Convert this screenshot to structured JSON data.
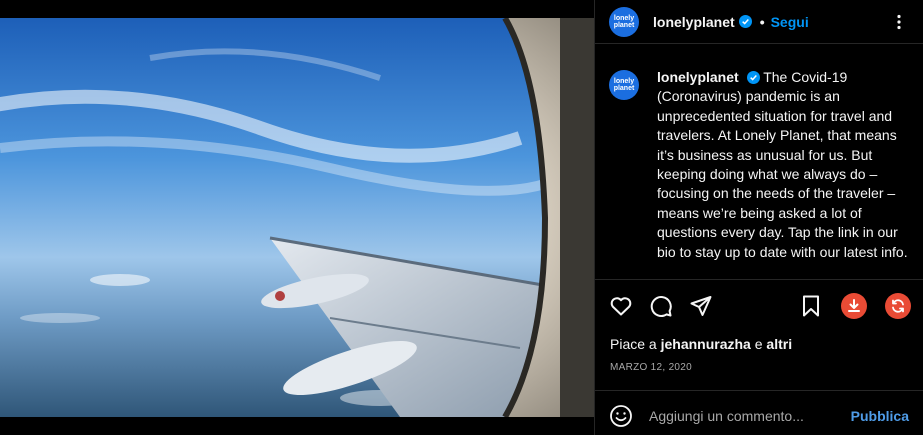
{
  "post": {
    "image_alt": "Airplane wing seen through cabin window above the clouds"
  },
  "header": {
    "avatar_line1": "lonely",
    "avatar_line2": "planet",
    "username": "lonelyplanet",
    "separator": "•",
    "follow_label": "Segui"
  },
  "caption": {
    "username": "lonelyplanet",
    "text": "The Covid-19 (Coronavirus) pandemic is an unprecedented situation for travel and travelers. At Lonely Planet, that means it’s business as unusual for us. But keeping doing what we always do – focusing on the needs of the traveler – means we’re being asked a lot of questions every day. Tap the link in our bio to stay up to date with our latest info."
  },
  "likes": {
    "prefix": "Piace a",
    "user": "jehannurazha",
    "conjunction": "e",
    "others": "altri"
  },
  "date": "MARZO 12, 2020",
  "comment": {
    "placeholder": "Aggiungi un commento...",
    "publish_label": "Pubblica"
  },
  "colors": {
    "accent": "#0095f6",
    "avatar_bg": "#1b6ee0",
    "extension_button": "#e94b35"
  },
  "icons": [
    "more-icon",
    "verified-icon",
    "heart-icon",
    "comment-icon",
    "share-icon",
    "bookmark-icon",
    "download-icon",
    "refresh-icon",
    "emoji-icon"
  ]
}
